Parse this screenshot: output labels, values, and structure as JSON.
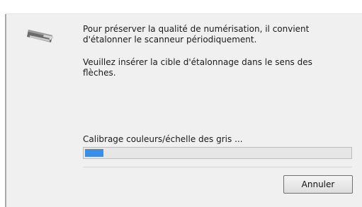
{
  "dialog": {
    "icon": "scanner-icon",
    "message_line1": "Pour préserver la qualité de numérisation, il convient d'étalonner le scanneur périodiquement.",
    "message_line2": "Veuillez insérer la cible d'étalonnage dans le sens des flèches.",
    "status": "Calibrage couleurs/échelle des gris ...",
    "progress_fraction": 0.07,
    "progress_color": "#3b8ee8",
    "cancel_label": "Annuler"
  }
}
